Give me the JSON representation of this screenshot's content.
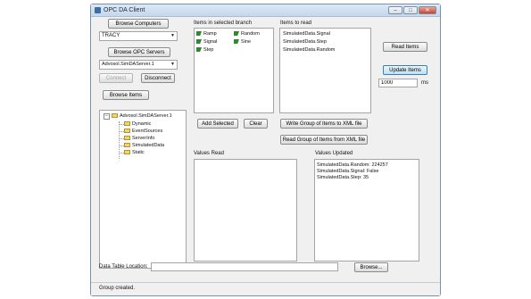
{
  "window": {
    "title": "OPC DA Client",
    "minimize_glyph": "–",
    "maximize_glyph": "□",
    "close_glyph": "✕"
  },
  "left": {
    "browse_computers_label": "Browse Computers",
    "computer_value": "TRACY",
    "browse_servers_label": "Browse OPC Servers",
    "server_value": "Advosol.SimDAServer.1",
    "connect_label": "Connect",
    "disconnect_label": "Disconnect",
    "browse_items_label": "Browse Items",
    "tree": {
      "root": "Advosol.SimDAServer.1",
      "collapse_glyph": "−",
      "children": [
        "Dynamic",
        "EventSources",
        "ServerInfo",
        "SimulatedData",
        "Static"
      ]
    }
  },
  "branch": {
    "title": "Items in selected branch",
    "items": [
      "Ramp",
      "Random",
      "Signal",
      "Sine",
      "Step"
    ],
    "add_selected_label": "Add Selected",
    "clear_label": "Clear"
  },
  "toread": {
    "title": "Items to read",
    "items": [
      "SimulatedData.Signal",
      "SimulatedData.Step",
      "SimulatedData.Random"
    ],
    "write_xml_label": "Write Group of Items to XML file",
    "read_xml_label": "Read Group of Items from XML file"
  },
  "right": {
    "read_items_label": "Read Items",
    "update_items_label": "Update Items",
    "interval_value": "1000",
    "interval_unit": "ms"
  },
  "values_read": {
    "title": "Values Read",
    "lines": []
  },
  "values_updated": {
    "title": "Values Updated",
    "lines": [
      "SimulatedData.Random: 224257",
      "SimulatedData.Signal: False",
      "SimulatedData.Step: 35"
    ]
  },
  "footer": {
    "data_table_label": "Data Table Location:",
    "data_table_value": "",
    "browse_label": "Browse...",
    "status_text": "Group created."
  }
}
